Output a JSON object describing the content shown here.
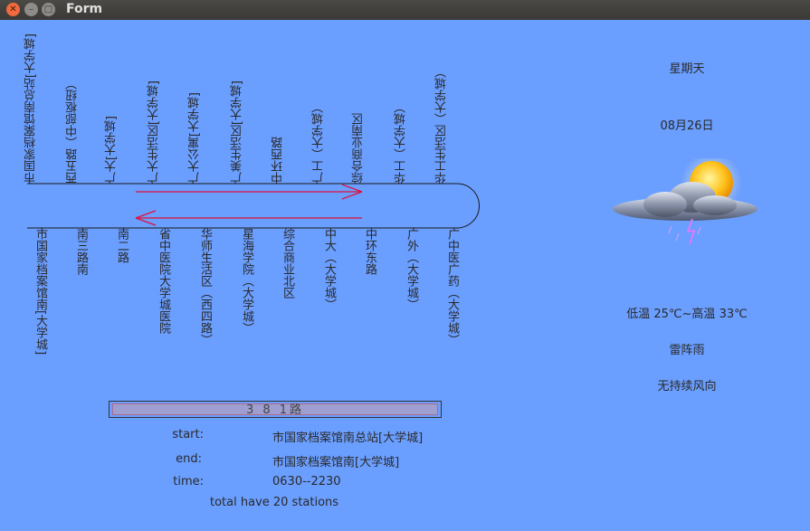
{
  "window": {
    "title": "Form"
  },
  "stations_top": [
    "市国家档案馆南总站[大学城]",
    "西五路（中部枢纽）",
    "广大[大学城]",
    "广大生活区[大学城]",
    "广大公寓[大学城]",
    "广美生活区[大学城]",
    "中环西路",
    "广工（大学城）",
    "综合商业南区",
    "华工（大学城）",
    "华工生活区（大学城）"
  ],
  "stations_bottom": [
    "市国家档案馆南[大学城]",
    "南三路南",
    "南二路",
    "省中医院大学城医院",
    "华师生活区（西四路）",
    "星海学院（大学城）",
    "综合商业北区",
    "中大（大学城）",
    "中环东路",
    "广外（大学城）",
    "广中医广药（大学城）"
  ],
  "weather": {
    "weekday": "星期天",
    "date": "08月26日",
    "temperature": "低温 25℃~高温 33℃",
    "condition": "雷阵雨",
    "wind": "无持续风向",
    "icon": "thunderstorm-sun-icon"
  },
  "route": {
    "name": "3 8 1路",
    "start_label": "start:",
    "start_value": "市国家档案馆南总站[大学城]",
    "end_label": "end:",
    "end_value": "市国家档案馆南[大学城]",
    "time_label": "time:",
    "time_value": "0630--2230",
    "total": "total have 20 stations"
  },
  "colors": {
    "background": "#6a9eff",
    "arrow": "#e0103a"
  }
}
